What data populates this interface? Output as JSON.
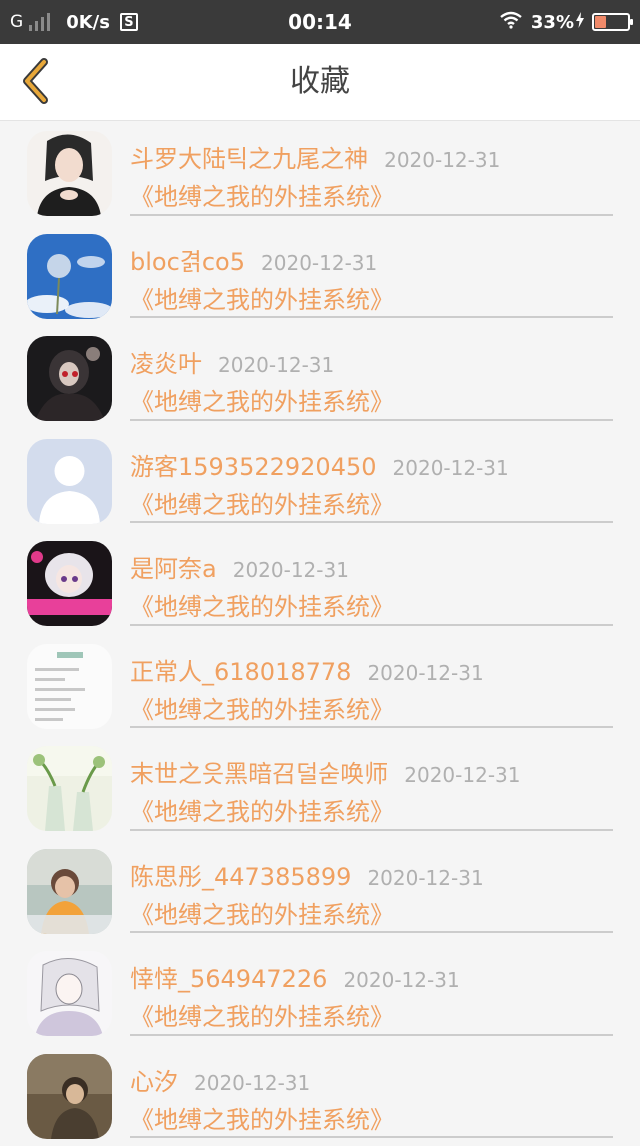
{
  "status": {
    "carrier": "G",
    "speed": "0K/s",
    "s_icon": "S",
    "time": "00:14",
    "battery": "33%",
    "battery_level": 0.33,
    "wifi_icon": "wifi-icon",
    "charging_icon": "charging-bolt-icon"
  },
  "header": {
    "title": "收藏",
    "back_icon": "chevron-left-icon",
    "accent": "#e8a83a"
  },
  "colors": {
    "name": "#f0a060",
    "date": "#b0b0b0",
    "divider": "#cccccc"
  },
  "items": [
    {
      "name": "斗罗大陆틱之九尾之神",
      "date": "2020-12-31",
      "book": "《地缚之我的外挂系统》"
    },
    {
      "name": "bloc겱co5",
      "date": "2020-12-31",
      "book": "《地缚之我的外挂系统》"
    },
    {
      "name": "凌炎叶",
      "date": "2020-12-31",
      "book": "《地缚之我的外挂系统》"
    },
    {
      "name": "游客1593522920450",
      "date": "2020-12-31",
      "book": "《地缚之我的外挂系统》"
    },
    {
      "name": "是阿奈a",
      "date": "2020-12-31",
      "book": "《地缚之我的外挂系统》"
    },
    {
      "name": "正常人_618018778",
      "date": "2020-12-31",
      "book": "《地缚之我的外挂系统》"
    },
    {
      "name": "末世之읏黑暗召덜숟唤师",
      "date": "2020-12-31",
      "book": "《地缚之我的外挂系统》"
    },
    {
      "name": "陈思彤_447385899",
      "date": "2020-12-31",
      "book": "《地缚之我的外挂系统》"
    },
    {
      "name": "悻悻_564947226",
      "date": "2020-12-31",
      "book": "《地缚之我的外挂系统》"
    },
    {
      "name": "心汐",
      "date": "2020-12-31",
      "book": "《地缚之我的外挂系统》"
    }
  ]
}
